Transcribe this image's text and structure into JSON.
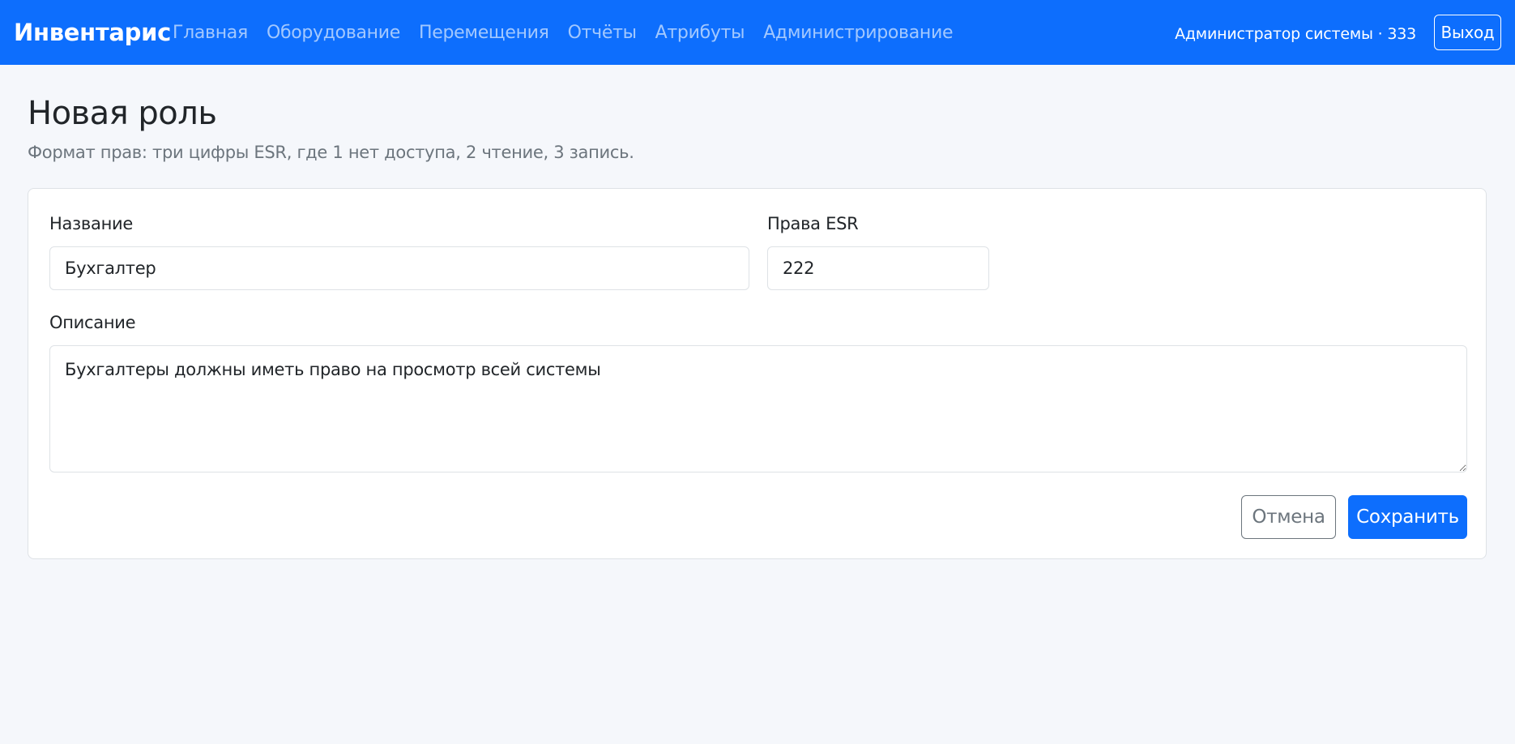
{
  "navbar": {
    "brand": "Инвентарис",
    "links": [
      "Главная",
      "Оборудование",
      "Перемещения",
      "Отчёты",
      "Атрибуты",
      "Администрирование"
    ],
    "user": "Администратор системы · 333",
    "logout_label": "Выход"
  },
  "page": {
    "title": "Новая роль",
    "subtitle": "Формат прав: три цифры ESR, где 1 нет доступа, 2 чтение, 3 запись."
  },
  "form": {
    "name_label": "Название",
    "name_value": "Бухгалтер",
    "rights_label": "Права ESR",
    "rights_value": "222",
    "description_label": "Описание",
    "description_value": "Бухгалтеры должны иметь право на просмотр всей системы",
    "cancel_label": "Отмена",
    "save_label": "Сохранить"
  },
  "colors": {
    "primary": "#0d6efd",
    "page_background": "#f5f7fb",
    "muted_text": "#6c757d"
  }
}
